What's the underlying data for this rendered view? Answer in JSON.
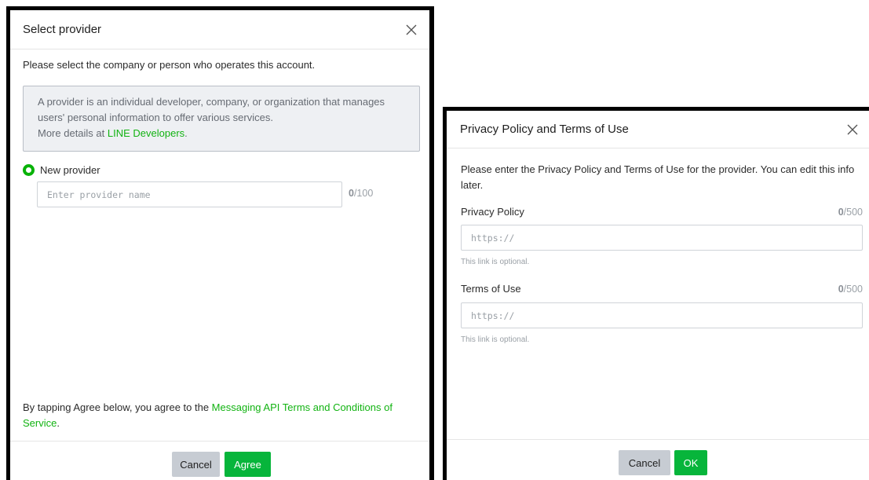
{
  "select_provider": {
    "title": "Select provider",
    "description": "Please select the company or person who operates this account.",
    "info_text": "A provider is an individual developer, company, or organization that manages users' personal information to offer various services.",
    "info_more_prefix": "More details at ",
    "info_link": "LINE Developers",
    "info_more_suffix": ".",
    "radio_label": "New provider",
    "input_placeholder": "Enter provider name",
    "counter_value": "0",
    "counter_max": "/100",
    "terms_prefix": "By tapping Agree below, you agree to the ",
    "terms_link": "Messaging API Terms and Conditions of Service",
    "terms_suffix": ".",
    "cancel_label": "Cancel",
    "agree_label": "Agree"
  },
  "privacy_terms": {
    "title": "Privacy Policy and Terms of Use",
    "description": "Please enter the Privacy Policy and Terms of Use for the provider. You can edit this info later.",
    "privacy_label": "Privacy Policy",
    "privacy_counter_value": "0",
    "privacy_counter_max": "/500",
    "privacy_placeholder": "https://",
    "privacy_hint": "This link is optional.",
    "terms_label": "Terms of Use",
    "terms_counter_value": "0",
    "terms_counter_max": "/500",
    "terms_placeholder": "https://",
    "terms_hint": "This link is optional.",
    "cancel_label": "Cancel",
    "ok_label": "OK"
  },
  "icons": {
    "close": "close-icon",
    "radio": "radio-selected"
  },
  "colors": {
    "accent_green": "#07b53b",
    "link_green": "#12b312",
    "cancel_gray": "#c7ccd3",
    "info_bg": "#eef0f3"
  }
}
